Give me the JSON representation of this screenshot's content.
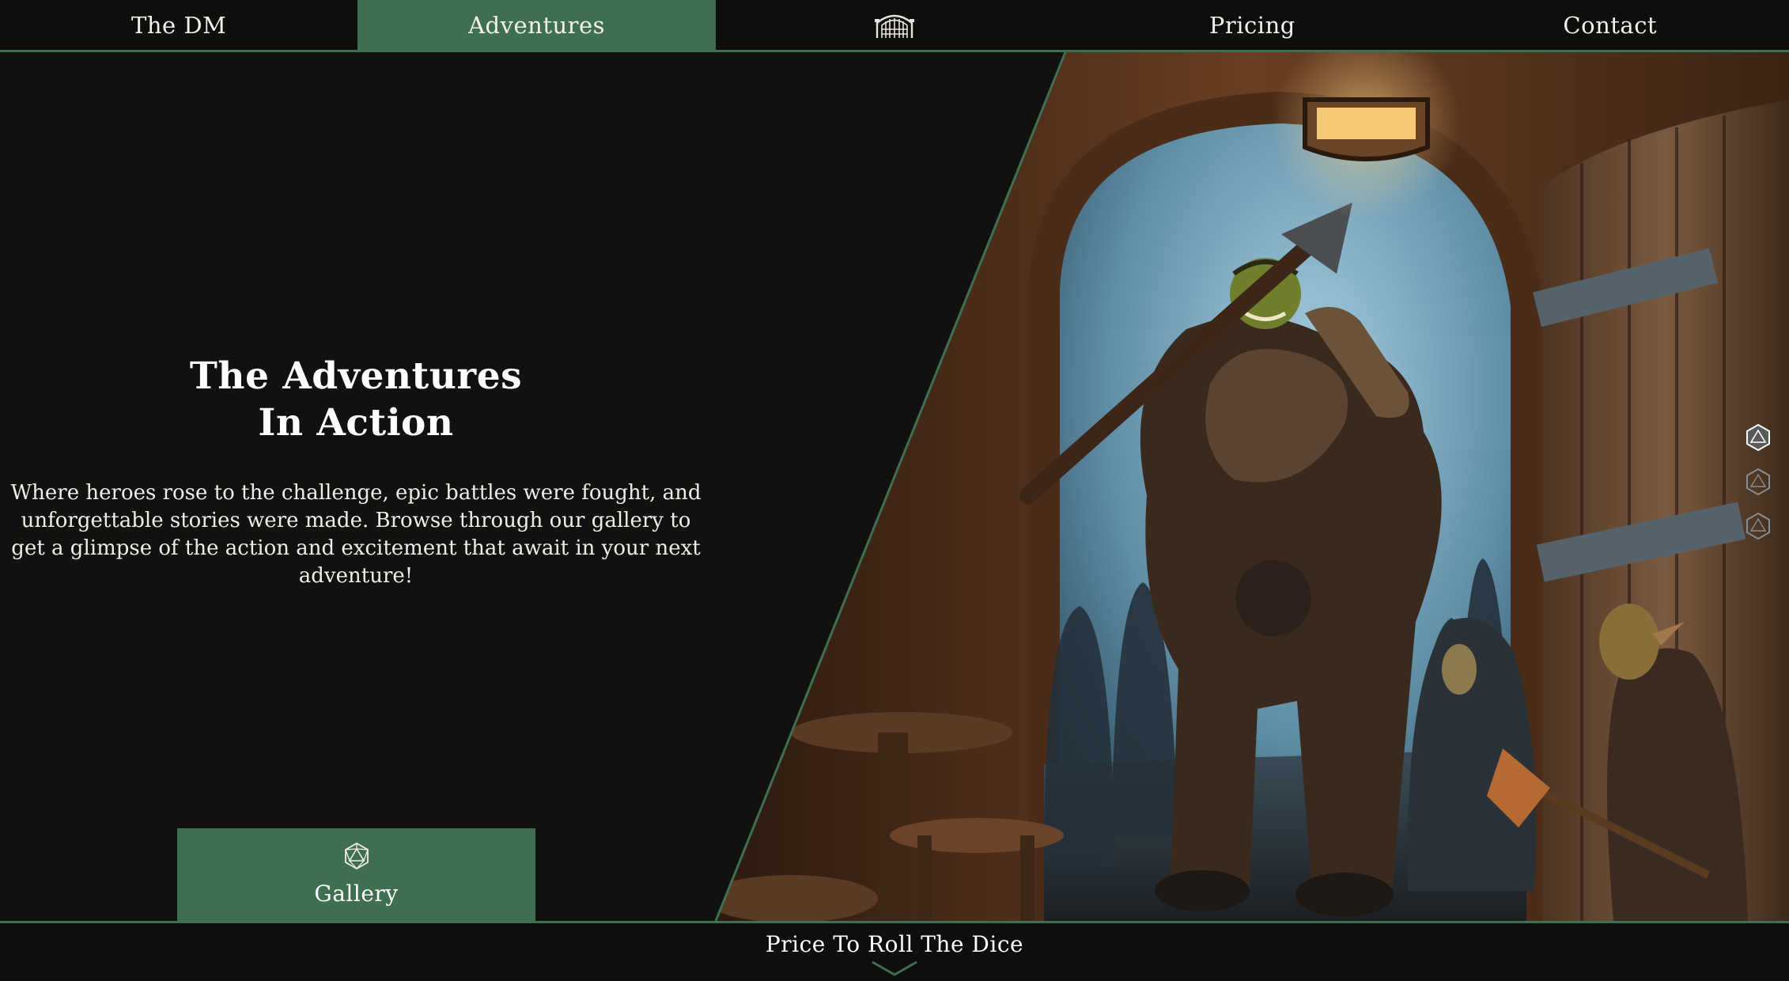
{
  "nav": {
    "items": [
      {
        "label": "The DM",
        "active": false
      },
      {
        "label": "Adventures",
        "active": true
      },
      {
        "label": "",
        "icon": "castle-gate-icon"
      },
      {
        "label": "Pricing",
        "active": false
      },
      {
        "label": "Contact",
        "active": false
      }
    ]
  },
  "hero": {
    "title_line1": "The Adventures",
    "title_line2": "In Action",
    "description": "Where heroes rose to the challenge, epic battles were fought, and unforgettable stories were made. Browse through our gallery to get a glimpse of the action and excitement that await in your next adventure!",
    "gallery_button": {
      "label": "Gallery",
      "icon": "d20-dice-icon"
    },
    "image": {
      "icon": "orc-tavern-illustration"
    },
    "slider": {
      "count": 3,
      "active_index": 0
    }
  },
  "footer": {
    "scroll_label": "Price To Roll The Dice",
    "icon": "chevron-down-icon"
  },
  "colors": {
    "accent": "#3e6f50",
    "background": "#111110",
    "text": "#f2f0ea"
  }
}
